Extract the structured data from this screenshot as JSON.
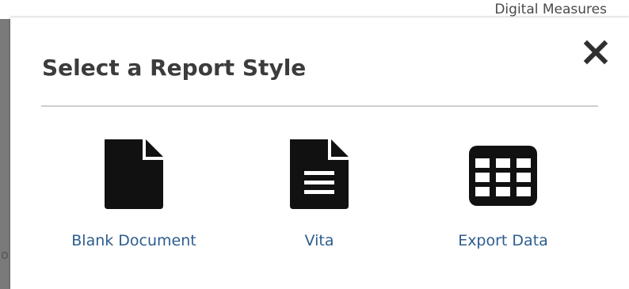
{
  "background": {
    "header_text": "Digital Measures",
    "left_glyph": "o"
  },
  "modal": {
    "title": "Select a Report Style",
    "close_icon": "close-x-icon",
    "options": [
      {
        "label": "Blank Document",
        "icon": "blank-document-icon"
      },
      {
        "label": "Vita",
        "icon": "text-document-icon"
      },
      {
        "label": "Export Data",
        "icon": "table-grid-icon"
      }
    ]
  },
  "colors": {
    "overlay": "#7a7a7a",
    "title": "#3c3c3c",
    "link": "#2d5d8f",
    "icon": "#111111",
    "divider": "#cfcfcf"
  }
}
